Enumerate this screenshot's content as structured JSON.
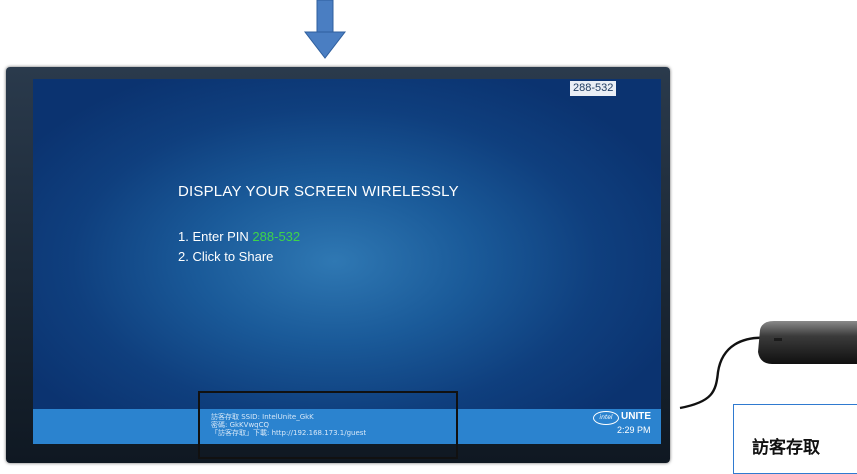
{
  "screen": {
    "pin_corner": "288-532",
    "headline": "DISPLAY YOUR SCREEN WIRELESSLY",
    "step1_prefix": "1. Enter PIN ",
    "pin": "288-532",
    "step2": "2. Click to Share"
  },
  "bottom_bar": {
    "guest_line1": "訪客存取 SSID: IntelUnite_GkK",
    "guest_line2": "密碼: GkKVwqCQ",
    "guest_line3": "「訪客存取」下載: http://192.168.173.1/guest",
    "brand": "UNITE",
    "intel": "intel",
    "time": "2:29 PM"
  },
  "callout": {
    "text": "訪客存取"
  },
  "colors": {
    "arrow": "#4a7ec2",
    "pin_green": "#3ed44a",
    "bar_blue": "#2b83cf"
  }
}
